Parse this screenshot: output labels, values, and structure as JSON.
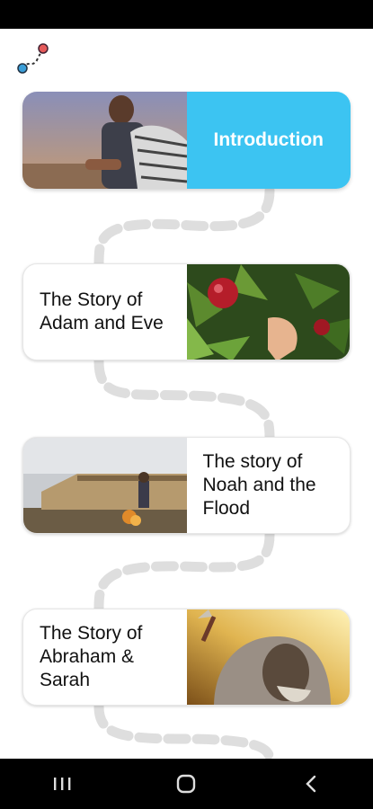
{
  "app": {
    "route_icon": "route-path-icon",
    "accent_color": "#3cc4f2"
  },
  "lessons": [
    {
      "title": "Introduction",
      "image": "man-in-headscarf-desert-photo",
      "image_side": "left"
    },
    {
      "title": "The Story of Adam and Eve",
      "image": "hand-reaching-apple-tree-photo",
      "image_side": "right"
    },
    {
      "title": "The story of Noah and the Flood",
      "image": "man-before-ark-photo",
      "image_side": "left"
    },
    {
      "title": "The Story of Abraham & Sarah",
      "image": "old-man-raising-knife-photo",
      "image_side": "right"
    }
  ],
  "nav": {
    "recent_icon": "recent-apps-icon",
    "home_icon": "home-icon",
    "back_icon": "back-icon"
  }
}
